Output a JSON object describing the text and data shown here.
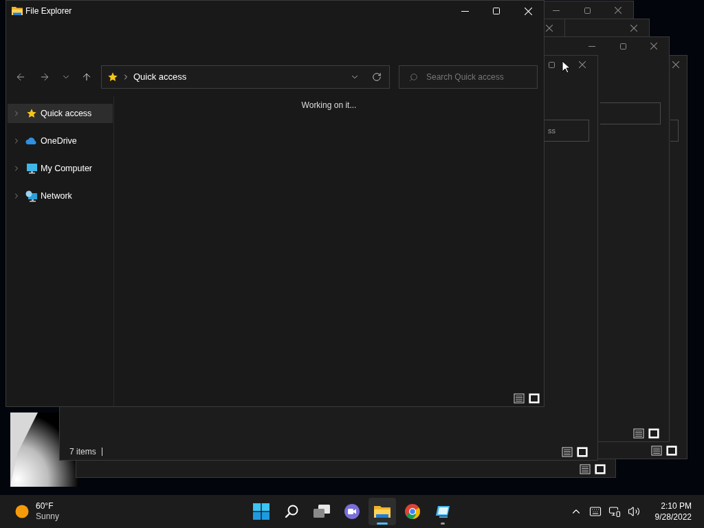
{
  "background_windows": [
    {
      "views": [
        {
          "kind": "details",
          "selected": false
        },
        {
          "kind": "tiles",
          "selected": true
        }
      ]
    },
    {
      "controls": [
        {
          "kind": "close"
        }
      ],
      "search_field": true,
      "views": [
        {
          "kind": "details",
          "selected": false
        },
        {
          "kind": "tiles",
          "selected": true
        }
      ]
    },
    {
      "controls": [
        {
          "kind": "minimize"
        },
        {
          "kind": "maximize"
        },
        {
          "kind": "close"
        }
      ]
    },
    {
      "controls": [
        {
          "kind": "close"
        }
      ]
    },
    {
      "controls": [
        {
          "kind": "close"
        }
      ]
    },
    {
      "controls": [
        {
          "kind": "minimize"
        },
        {
          "kind": "maximize"
        },
        {
          "kind": "close"
        }
      ],
      "search_field": true,
      "views": [
        {
          "kind": "details",
          "selected": false
        },
        {
          "kind": "tiles",
          "selected": true
        }
      ]
    },
    {
      "controls": [
        {
          "kind": "maximize"
        },
        {
          "kind": "close"
        }
      ],
      "search_field": true,
      "search_text": "ss",
      "status": "7 items",
      "views": [
        {
          "kind": "details",
          "selected": false
        },
        {
          "kind": "tiles",
          "selected": true
        }
      ]
    }
  ],
  "window": {
    "title": "File Explorer",
    "controls": [
      {
        "kind": "minimize"
      },
      {
        "kind": "maximize"
      },
      {
        "kind": "close"
      }
    ],
    "address": "Quick access",
    "search": {
      "placeholder": "Search Quick access"
    },
    "sidebar": {
      "items": [
        {
          "label": "Quick access",
          "kind": "star",
          "selected": true,
          "expanded": false
        },
        {
          "label": "OneDrive",
          "kind": "cloud",
          "selected": false,
          "expanded": false
        },
        {
          "label": "My Computer",
          "kind": "computer",
          "selected": false,
          "expanded": false
        },
        {
          "label": "Network",
          "kind": "network",
          "selected": false,
          "expanded": false
        }
      ]
    },
    "message": "Working on it...",
    "views": [
      {
        "kind": "details",
        "selected": false
      },
      {
        "kind": "tiles",
        "selected": true
      }
    ]
  },
  "taskbar": {
    "weather": {
      "temperature": "60°F",
      "condition": "Sunny"
    },
    "apps": [
      {
        "kind": "start",
        "selected": false,
        "running": false
      },
      {
        "kind": "search",
        "selected": false,
        "running": false
      },
      {
        "kind": "task-view",
        "selected": false,
        "running": false
      },
      {
        "kind": "chat",
        "selected": false,
        "running": false
      },
      {
        "kind": "file-explorer",
        "selected": true,
        "running": true
      },
      {
        "kind": "chrome",
        "selected": false,
        "running": false
      },
      {
        "kind": "remote",
        "selected": false,
        "running": true
      }
    ],
    "tray": [
      {
        "kind": "chevron"
      },
      {
        "kind": "keyboard"
      },
      {
        "kind": "network"
      },
      {
        "kind": "volume"
      }
    ],
    "time": "2:10 PM",
    "date": "9/28/2022"
  }
}
